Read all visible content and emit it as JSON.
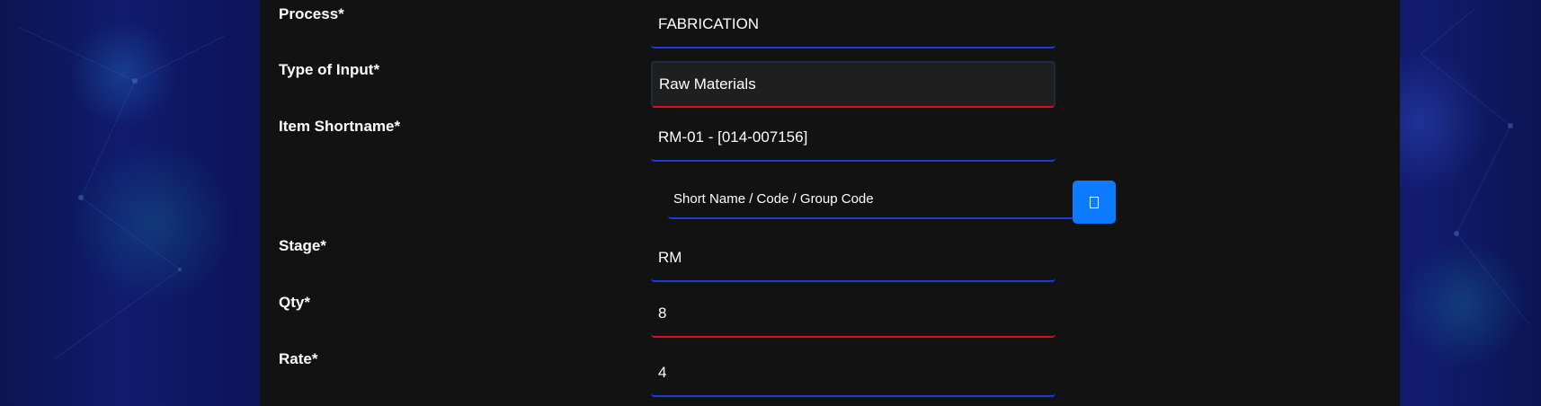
{
  "form": {
    "rows": [
      {
        "label": "Process*",
        "value": "FABRICATION"
      },
      {
        "label": "Type of Input*",
        "value": "Raw Materials"
      },
      {
        "label": "Item Shortname*",
        "value": "RM-01 - [014-007156]"
      },
      {
        "label": "Stage*",
        "value": "RM"
      },
      {
        "label": "Qty*",
        "value": "8"
      },
      {
        "label": "Rate*",
        "value": "4"
      }
    ],
    "search": {
      "placeholder": "Short Name / Code / Group Code",
      "button_icon": "search-icon"
    }
  },
  "colors": {
    "panel": "#121212",
    "accent_blue": "#1f3ae0",
    "error_red": "#d4121c",
    "button_blue": "#0d7bff"
  }
}
